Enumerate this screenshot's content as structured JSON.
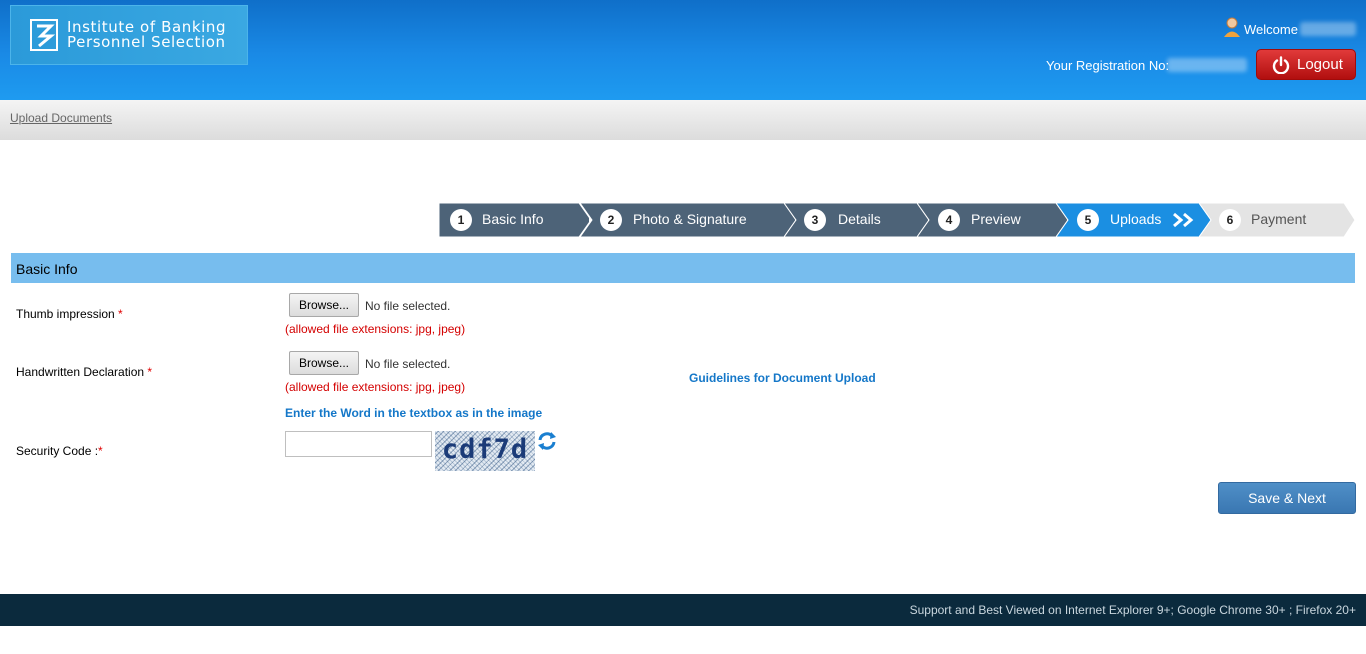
{
  "header": {
    "logo_text_line1": "Institute of Banking",
    "logo_text_line2": "Personnel Selection",
    "welcome_label": "Welcome",
    "registration_label": "Your Registration No:",
    "logout_label": "Logout"
  },
  "breadcrumb": "Upload Documents",
  "steps": [
    {
      "number": "1",
      "label": "Basic Info"
    },
    {
      "number": "2",
      "label": "Photo & Signature"
    },
    {
      "number": "3",
      "label": "Details"
    },
    {
      "number": "4",
      "label": "Preview"
    },
    {
      "number": "5",
      "label": "Uploads"
    },
    {
      "number": "6",
      "label": "Payment"
    }
  ],
  "active_step": "5",
  "section_title": "Basic Info",
  "fields": {
    "thumb": {
      "label": "Thumb impression",
      "required_mark": "*",
      "browse_label": "Browse...",
      "file_status": "No file selected.",
      "extensions_note": "(allowed file extensions: jpg, jpeg)"
    },
    "declaration": {
      "label": "Handwritten Declaration",
      "required_mark": "*",
      "browse_label": "Browse...",
      "file_status": "No file selected.",
      "extensions_note": "(allowed file extensions: jpg, jpeg)"
    }
  },
  "guidelines_link": "Guidelines for Document Upload",
  "captcha_instruction": "Enter the Word in the textbox as in the image",
  "security_code": {
    "label": "Security Code :",
    "required_mark": "*",
    "value": "",
    "captcha_text": "cdf7d"
  },
  "save_label": "Save & Next",
  "footer_text": "Support and Best Viewed on Internet Explorer 9+; Google Chrome 30+ ; Firefox 20+",
  "colors": {
    "header_blue": "#1a8ae6",
    "step_dark": "#4a6076",
    "step_active": "#1a8fe0",
    "section_blue": "#77bdee",
    "logout_red": "#c41a1a",
    "footer_navy": "#0b2a3d"
  }
}
